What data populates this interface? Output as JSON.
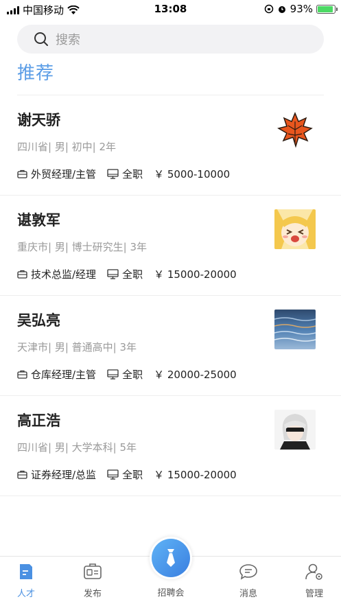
{
  "status_bar": {
    "carrier": "中国移动",
    "time": "13:08",
    "battery": "93%"
  },
  "search": {
    "placeholder": "搜索"
  },
  "section": {
    "title": "推荐"
  },
  "candidates": [
    {
      "name": "谢天骄",
      "info": "四川省| 男| 初中| 2年",
      "position": "外贸经理/主管",
      "job_type": "全职",
      "salary": "￥ 5000-10000"
    },
    {
      "name": "谌敦军",
      "info": "重庆市| 男| 博士研究生| 3年",
      "position": "技术总监/经理",
      "job_type": "全职",
      "salary": "￥ 15000-20000"
    },
    {
      "name": "吴弘亮",
      "info": "天津市| 男| 普通高中| 3年",
      "position": "仓库经理/主管",
      "job_type": "全职",
      "salary": "￥ 20000-25000"
    },
    {
      "name": "高正浩",
      "info": "四川省| 男| 大学本科| 5年",
      "position": "证券经理/总监",
      "job_type": "全职",
      "salary": "￥ 15000-20000"
    }
  ],
  "tabbar": {
    "talent": "人才",
    "publish": "发布",
    "fair": "招聘会",
    "messages": "消息",
    "manage": "管理"
  },
  "colors": {
    "accent": "#5b9de6",
    "active_tab": "#4a90e2"
  }
}
